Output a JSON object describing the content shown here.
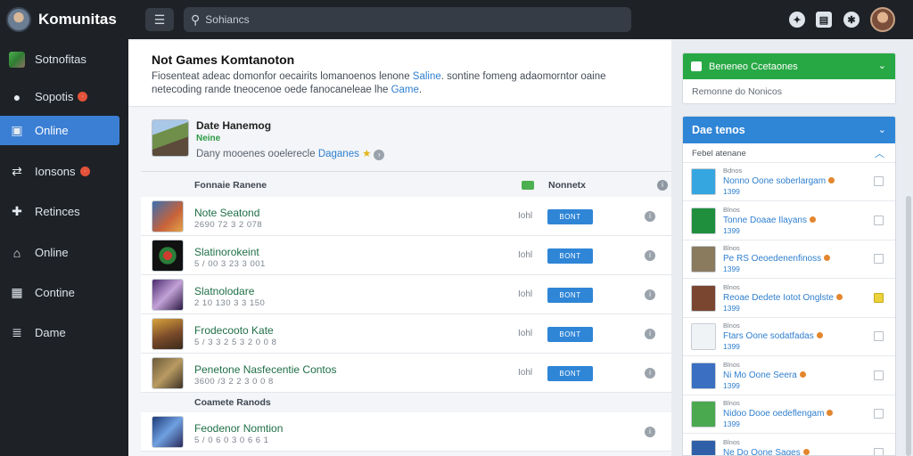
{
  "app": {
    "title": "Komunitas"
  },
  "search": {
    "placeholder": "Sohiancs",
    "value": ""
  },
  "sidebar": {
    "items": [
      {
        "label": "Sotnofitas",
        "icon": "game-thumbnail-icon",
        "badge": ""
      },
      {
        "label": "Sopotis",
        "icon": "user-icon",
        "badge": "·"
      },
      {
        "label": "Online",
        "icon": "window-icon",
        "badge": "",
        "active": true
      },
      {
        "label": "Ionsons",
        "icon": "share-icon",
        "badge": "·"
      },
      {
        "label": "Retinces",
        "icon": "puzzle-icon",
        "badge": ""
      },
      {
        "label": "Online",
        "icon": "store-icon",
        "badge": ""
      },
      {
        "label": "Contine",
        "icon": "grid-icon",
        "badge": ""
      },
      {
        "label": "Dame",
        "icon": "list-icon",
        "badge": ""
      }
    ]
  },
  "header": {
    "title": "Not Games Komtanoton",
    "desc_prefix": "Fiosenteat adeac domonfor oecairits lomanoenos lenone ",
    "desc_link1": "Saline",
    "desc_middle": ". sontine fomeng adaomorntor oaine netecoding rande tneocenoe oede fanocaneleae lhe ",
    "desc_link2": "Game",
    "desc_suffix": "."
  },
  "featured": {
    "title": "Date Hanemog",
    "status": "Neine",
    "desc_prefix": "Dany mooenes ooelerecle ",
    "desc_link": "Daganes",
    "star": "★"
  },
  "table": {
    "col_name": "Fonnaie Ranene",
    "col_status": "Nonnetx",
    "rows": [
      {
        "name": "Note Seatond",
        "sub": "2690 72 3 2 078",
        "stat": "Iohl",
        "button": "BONT"
      },
      {
        "name": "Slatinorokeint",
        "sub": "5 / 00 3 23 3 001",
        "stat": "Iohl",
        "button": "BONT"
      },
      {
        "name": "Slatnolodare",
        "sub": "2 10 130 3 3 150",
        "stat": "Iohl",
        "button": "BONT"
      },
      {
        "name": "Frodecooto Kate",
        "sub": "5 / 3 3 2 5 3 2 0 0 8",
        "stat": "Iohl",
        "button": "BONT"
      },
      {
        "name": "Penetone Nasfecentie Contos",
        "sub": "3600 /3 2 2 3 0 0 8",
        "stat": "Iohl",
        "button": "BONT"
      }
    ],
    "section_label": "Coamete Ranods",
    "section_rows": [
      {
        "name": "Feodenor Nomtion",
        "sub": "5 / 0 6 0 3 0 6 6 1"
      }
    ]
  },
  "right": {
    "green_title": "Beneneo Ccetaones",
    "green_body": "Remonne do Nonicos",
    "blue_title": "Dae tenos",
    "filter_label": "Febel atenane",
    "items": [
      {
        "tag": "Bdnos",
        "name": "Nonno Oone soberlargam",
        "year": "1399",
        "checked": false,
        "thumb": "#36a6e0"
      },
      {
        "tag": "Blnos",
        "name": "Tonne Doaae Ilayans",
        "year": "1399",
        "checked": false,
        "thumb": "#1f8e3d"
      },
      {
        "tag": "Blnos",
        "name": "Pe RS Oeoedenenfinoss",
        "year": "1399",
        "checked": false,
        "thumb": "#8a7a5e"
      },
      {
        "tag": "Blnos",
        "name": "Reoae Dedete Iotot Onglste",
        "year": "1399",
        "checked": true,
        "thumb": "#7a4630"
      },
      {
        "tag": "Blnos",
        "name": "Ftars Oone sodatfadas",
        "year": "1399",
        "checked": false,
        "thumb": "#f0f3f6"
      },
      {
        "tag": "Blnos",
        "name": "Ni Mo Oone Seera",
        "year": "1399",
        "checked": false,
        "thumb": "#3a6fc1"
      },
      {
        "tag": "Blnos",
        "name": "Nidoo Dooe oedeflengam",
        "year": "1399",
        "checked": false,
        "thumb": "#4aa84f"
      },
      {
        "tag": "Blnos",
        "name": "Ne Do Oone Sages",
        "year": "",
        "checked": false,
        "thumb": "#2f5fa8"
      }
    ]
  },
  "colors": {
    "accent": "#2f85d6",
    "success": "#27a844",
    "sidebar_bg": "#1e2227"
  }
}
